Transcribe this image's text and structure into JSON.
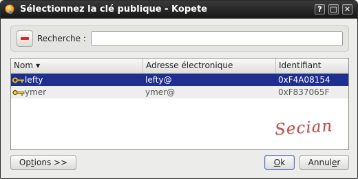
{
  "window": {
    "title": "Sélectionnez la clé publique - Kopete",
    "buttons": {
      "help": "?",
      "maximize": "□",
      "close": "✕"
    }
  },
  "search": {
    "label": "Recherche :",
    "value": "",
    "placeholder": ""
  },
  "table": {
    "columns": [
      "Nom",
      "Adresse électronique",
      "Identifiant"
    ],
    "rows": [
      {
        "name": "lefty",
        "email": "lefty@",
        "id": "0xF4A08154",
        "selected": true
      },
      {
        "name": "ymer",
        "email": "ymer@",
        "id": "0xF837065F",
        "selected": false
      }
    ]
  },
  "watermark": "Secian",
  "buttons": {
    "options": {
      "underlined": "t",
      "rest": "ions >>",
      "prefix": "Op"
    },
    "ok": {
      "underlined": "O",
      "rest": "k"
    },
    "cancel": {
      "prefix": "Annul",
      "underlined": "e",
      "rest": "r"
    }
  },
  "colors": {
    "selection": "#1f2f8f",
    "titlebar": "#1e1e1e",
    "key_gold": "#d8b400"
  }
}
